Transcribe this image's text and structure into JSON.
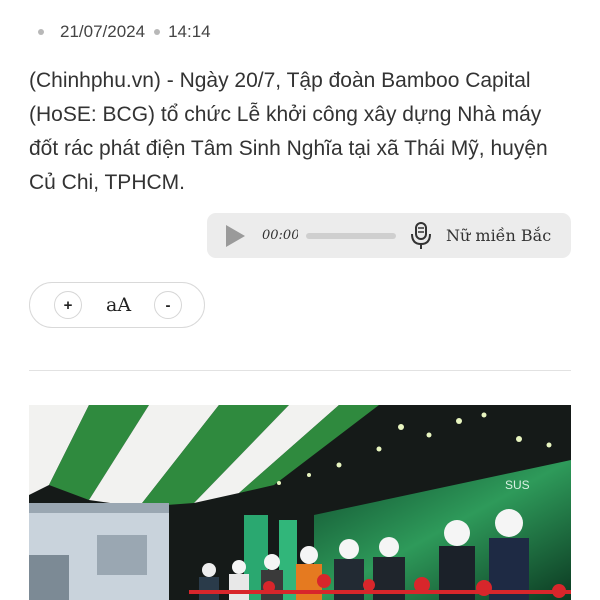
{
  "article": {
    "date": "21/07/2024",
    "time": "14:14",
    "lead": "(Chinhphu.vn) - Ngày 20/7, Tập đoàn Bamboo Capital (HoSE: BCG) tổ chức Lễ khởi công xây dựng Nhà máy đốt rác phát điện Tâm Sinh Nghĩa tại xã Thái Mỹ, huyện Củ Chi, TPHCM."
  },
  "audio_player": {
    "play_icon": "play-icon",
    "current_time": "00:00",
    "progress": 0,
    "mic_icon": "microphone-icon",
    "voice_label": "Nữ miền Bắc"
  },
  "font_size_control": {
    "increase_label": "+",
    "label": "aA",
    "decrease_label": "-"
  },
  "photo": {
    "logo_text": "SUS",
    "colors": {
      "tent_green": "#2f8a3e",
      "stage_green": "#1f7a4a",
      "ribbon_red": "#d8262b"
    }
  }
}
